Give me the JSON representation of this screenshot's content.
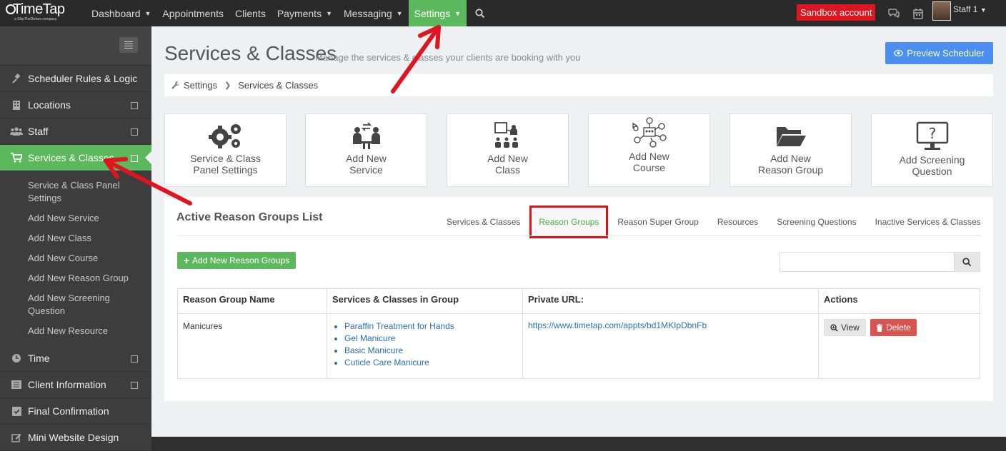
{
  "topnav": {
    "brand": "TimeTap",
    "brand_sub": "a SkipTheDishes company",
    "items": [
      {
        "label": "Dashboard",
        "caret": true
      },
      {
        "label": "Appointments",
        "caret": false
      },
      {
        "label": "Clients",
        "caret": false
      },
      {
        "label": "Payments",
        "caret": true
      },
      {
        "label": "Messaging",
        "caret": true
      },
      {
        "label": "Settings",
        "caret": true,
        "active": true
      }
    ],
    "sandbox": "Sandbox account",
    "staff": "Staff 1"
  },
  "sidebar": {
    "items": [
      {
        "label": "Scheduler Rules & Logic",
        "icon": "gavel-icon"
      },
      {
        "label": "Locations",
        "icon": "building-icon"
      },
      {
        "label": "Staff",
        "icon": "users-icon"
      },
      {
        "label": "Services & Classes",
        "icon": "cart-icon"
      },
      {
        "label": "Time",
        "icon": "clock-icon"
      },
      {
        "label": "Client Information",
        "icon": "list-icon"
      },
      {
        "label": "Final Confirmation",
        "icon": "check-square-icon"
      },
      {
        "label": "Mini Website Design",
        "icon": "edit-icon"
      }
    ],
    "sub_items": [
      "Service & Class Panel Settings",
      "Add New Service",
      "Add New Class",
      "Add New Course",
      "Add New Reason Group",
      "Add New Screening Question",
      "Add New Resource"
    ]
  },
  "page": {
    "title": "Services & Classes",
    "subtitle": "Manage the services & classes your clients are booking with you",
    "preview_button": "Preview Scheduler",
    "breadcrumb": [
      "Settings",
      "Services & Classes"
    ]
  },
  "tiles": [
    {
      "label1": "Service & Class",
      "label2": "Panel Settings",
      "icon": "gears-icon"
    },
    {
      "label1": "Add New",
      "label2": "Service",
      "icon": "service-exchange-icon"
    },
    {
      "label1": "Add New",
      "label2": "Class",
      "icon": "class-presentation-icon"
    },
    {
      "label1": "Add New",
      "label2": "Course",
      "icon": "course-network-icon"
    },
    {
      "label1": "Add New",
      "label2": "Reason Group",
      "icon": "folder-open-icon"
    },
    {
      "label1": "Add Screening",
      "label2": "Question",
      "icon": "monitor-question-icon"
    }
  ],
  "list": {
    "title": "Active Reason Groups List",
    "tabs": [
      "Services & Classes",
      "Reason Groups",
      "Reason Super Group",
      "Resources",
      "Screening Questions",
      "Inactive Services & Classes"
    ],
    "active_tab": "Reason Groups",
    "add_button": "Add New Reason Groups",
    "search_placeholder": "",
    "columns": [
      "Reason Group Name",
      "Services & Classes in Group",
      "Private URL:",
      "Actions"
    ],
    "rows": [
      {
        "name": "Manicures",
        "services": [
          "Paraffin Treatment for Hands",
          "Gel Manicure",
          "Basic Manicure",
          "Cuticle Care Manicure"
        ],
        "url": "https://www.timetap.com/appts/bd1MKIpDbnFb",
        "view": "View",
        "delete": "Delete"
      }
    ]
  },
  "colors": {
    "accent_green": "#5cb85c",
    "annotation_red": "#e0141e",
    "primary_blue": "#4b8ff0",
    "danger": "#d9534f"
  }
}
